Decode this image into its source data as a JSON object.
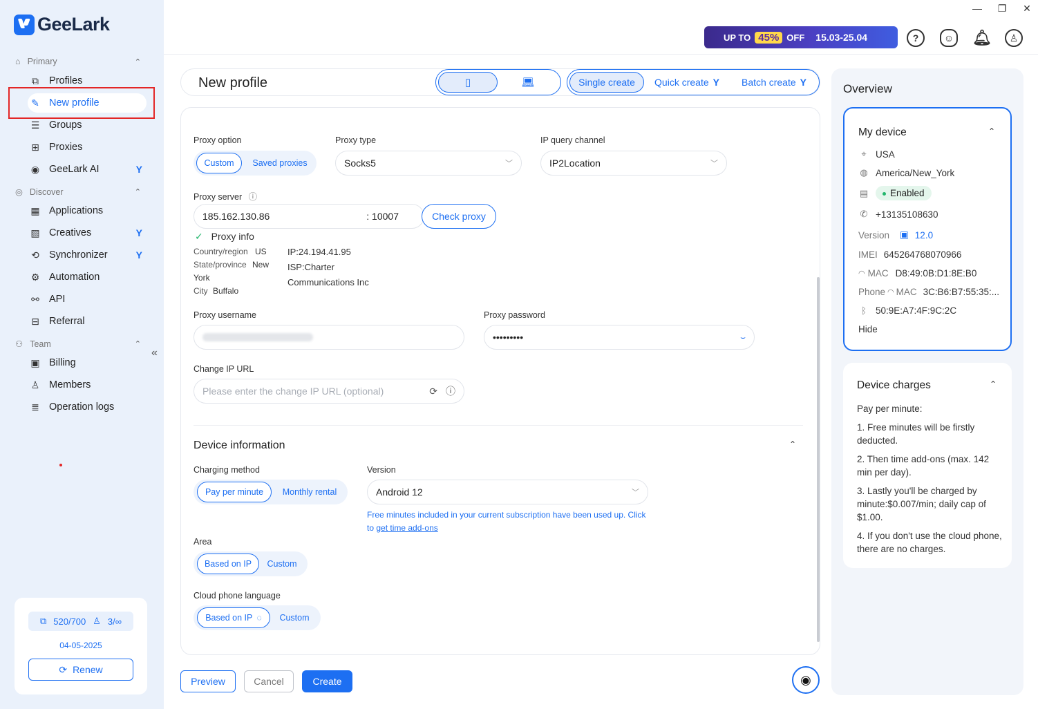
{
  "app": {
    "logo_text": "GeeLark"
  },
  "sidebar": {
    "sections": {
      "primary": "Primary",
      "discover": "Discover",
      "team": "Team"
    },
    "items": {
      "profiles": "Profiles",
      "new_profile": "New profile",
      "groups": "Groups",
      "proxies": "Proxies",
      "geelark_ai": "GeeLark AI",
      "applications": "Applications",
      "creatives": "Creatives",
      "synchronizer": "Synchronizer",
      "automation": "Automation",
      "api": "API",
      "referral": "Referral",
      "billing": "Billing",
      "members": "Members",
      "operation_logs": "Operation logs"
    },
    "quota": {
      "profiles": "520/700",
      "members": "3/∞",
      "date": "04-05-2025",
      "renew_label": "Renew"
    }
  },
  "topbar": {
    "promo": {
      "up_to": "UP TO",
      "percent": "45%",
      "off": "OFF",
      "dates": "15.03-25.04"
    }
  },
  "header": {
    "title": "New profile",
    "create_modes": {
      "single": "Single create",
      "quick": "Quick create",
      "batch": "Batch create"
    }
  },
  "proxy": {
    "option_label": "Proxy option",
    "option_custom": "Custom",
    "option_saved": "Saved proxies",
    "type_label": "Proxy type",
    "type_value": "Socks5",
    "channel_label": "IP query channel",
    "channel_value": "IP2Location",
    "server_label": "Proxy server",
    "server_host": "185.162.130.86",
    "server_port": ": 10007",
    "check_label": "Check proxy",
    "info_title": "Proxy info",
    "country_label": "Country/region",
    "country_value": "US",
    "state_label": "State/province",
    "state_value": "New",
    "state_value2": "York",
    "city_label": "City",
    "city_value": "Buffalo",
    "ip": "IP:24.194.41.95",
    "isp": "ISP:Charter",
    "isp2": "Communications Inc",
    "username_label": "Proxy username",
    "password_label": "Proxy password",
    "password_value": "•••••••••",
    "change_ip_label": "Change IP URL",
    "change_ip_placeholder": "Please enter the change IP URL (optional)"
  },
  "device_info": {
    "title": "Device information",
    "charging_label": "Charging method",
    "charging_per_minute": "Pay per minute",
    "charging_monthly": "Monthly rental",
    "version_label": "Version",
    "version_value": "Android 12",
    "note_text": "Free minutes included in your current subscription have been used up. Click to",
    "note_link": "get time add-ons",
    "area_label": "Area",
    "area_ip": "Based on IP",
    "area_custom": "Custom",
    "lang_label": "Cloud phone language",
    "lang_ip": "Based on IP",
    "lang_custom": "Custom"
  },
  "actions": {
    "preview": "Preview",
    "cancel": "Cancel",
    "create": "Create"
  },
  "overview": {
    "title": "Overview",
    "my_device": {
      "title": "My device",
      "country": "USA",
      "timezone": "America/New_York",
      "status": "Enabled",
      "phone": "+13135108630",
      "version_label": "Version",
      "version_value": "12.0",
      "imei_label": "IMEI",
      "imei_value": "645264768070966",
      "mac_label": "MAC",
      "mac_value": "D8:49:0B:D1:8E:B0",
      "phone_mac_label1": "Phone",
      "phone_mac_label2": "MAC",
      "phone_mac_value": "3C:B6:B7:55:35:...",
      "bt_value": "50:9E:A7:4F:9C:2C",
      "hide_label": "Hide"
    },
    "charges": {
      "title": "Device charges",
      "heading": "Pay per minute:",
      "p1": "1. Free minutes will be firstly deducted.",
      "p2": "2. Then time add-ons (max. 142 min per day).",
      "p3": "3. Lastly you'll be charged by minute:$0.007/min; daily cap of $1.00.",
      "p4": "4. If you don't use the cloud phone, there are no charges."
    }
  }
}
